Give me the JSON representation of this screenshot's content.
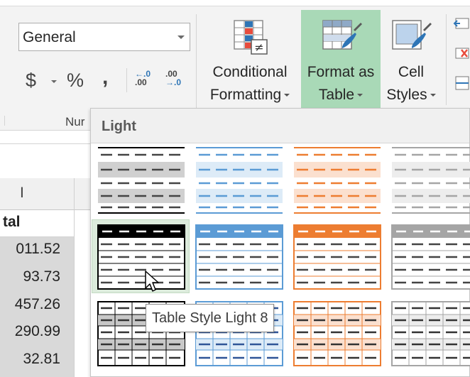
{
  "ribbon": {
    "number_format_value": "General",
    "currency_symbol": "$",
    "percent_symbol": "%",
    "comma_symbol": ",",
    "increase_decimal_top": "←.0",
    "increase_decimal_bottom": ".00",
    "decrease_decimal_top": ".00",
    "decrease_decimal_bottom": "→.0",
    "number_group_label": "Nur",
    "conditional_formatting": {
      "line1": "Conditional",
      "line2": "Formatting"
    },
    "format_as_table": {
      "line1": "Format as",
      "line2": "Table"
    },
    "cell_styles": {
      "line1": "Cell",
      "line2": "Styles"
    }
  },
  "sheet": {
    "column_header": "I",
    "total_header": "tal",
    "values": [
      "011.52",
      "93.73",
      "457.26",
      "290.99",
      "32.81"
    ]
  },
  "gallery": {
    "section_title": "Light",
    "tooltip": "Table Style Light 8",
    "colors": {
      "black": "#000000",
      "blue": "#5b9bd5",
      "orange": "#ed7d31",
      "gray": "#a5a5a5"
    }
  }
}
